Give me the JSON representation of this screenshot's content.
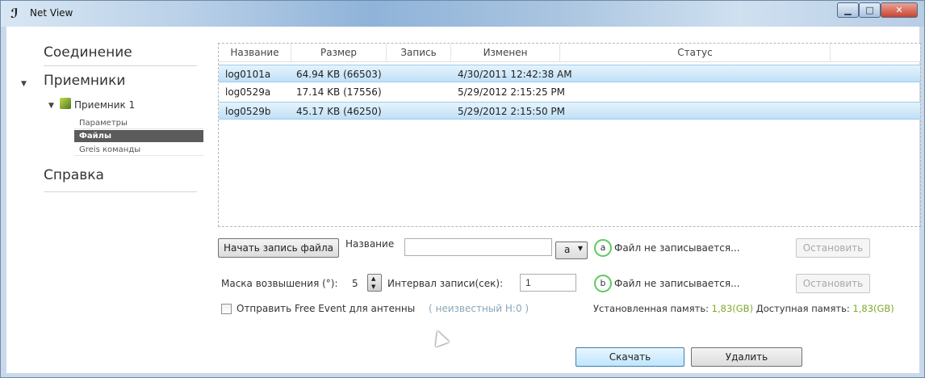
{
  "window": {
    "title": "Net View",
    "app_icon": "net-view-logo-icon"
  },
  "sidebar": {
    "connection": "Соединение",
    "receivers": "Приемники",
    "receiver1": "Приемник 1",
    "receiver1_items": [
      "Параметры",
      "Файлы",
      "Greis команды"
    ],
    "help": "Справка"
  },
  "filelist": {
    "columns": [
      "Название",
      "Размер",
      "Запись",
      "Изменен",
      "Статус"
    ],
    "rows": [
      {
        "name": "log0101a",
        "size": "64.94 KB (66503)",
        "record": "",
        "modified": "4/30/2011 12:42:38 AM",
        "status": "",
        "selected": true
      },
      {
        "name": "log0529a",
        "size": "17.14 KB (17556)",
        "record": "",
        "modified": "5/29/2012 2:15:25 PM",
        "status": "",
        "selected": false
      },
      {
        "name": "log0529b",
        "size": "45.17 KB (46250)",
        "record": "",
        "modified": "5/29/2012 2:15:50 PM",
        "status": "",
        "selected": true
      }
    ]
  },
  "recording": {
    "start_button": "Начать запись файла",
    "name_label": "Название",
    "name_value": "",
    "port_value": "a",
    "port_a": "a",
    "port_b": "b",
    "status_a": "Файл не записывается...",
    "status_b": "Файл не записывается...",
    "stop_label": "Остановить",
    "mask_label": "Маска возвышения (°):",
    "mask_value": "5",
    "interval_label": "Интервал записи(сек):",
    "interval_value": "1",
    "free_event_label": "Отправить Free Event для антенны",
    "antenna_state": "( неизвестный H:0 )",
    "mem_installed_label": "Установленная память:",
    "mem_installed_value": "1,83(GB)",
    "mem_available_label": "Доступная память:",
    "mem_available_value": "1,83(GB)"
  },
  "actions": {
    "download": "Скачать",
    "delete": "Удалить"
  },
  "colors": {
    "accent": "#bfe0f7",
    "status_ok": "#5fc95f",
    "memory": "#7fa82c"
  }
}
